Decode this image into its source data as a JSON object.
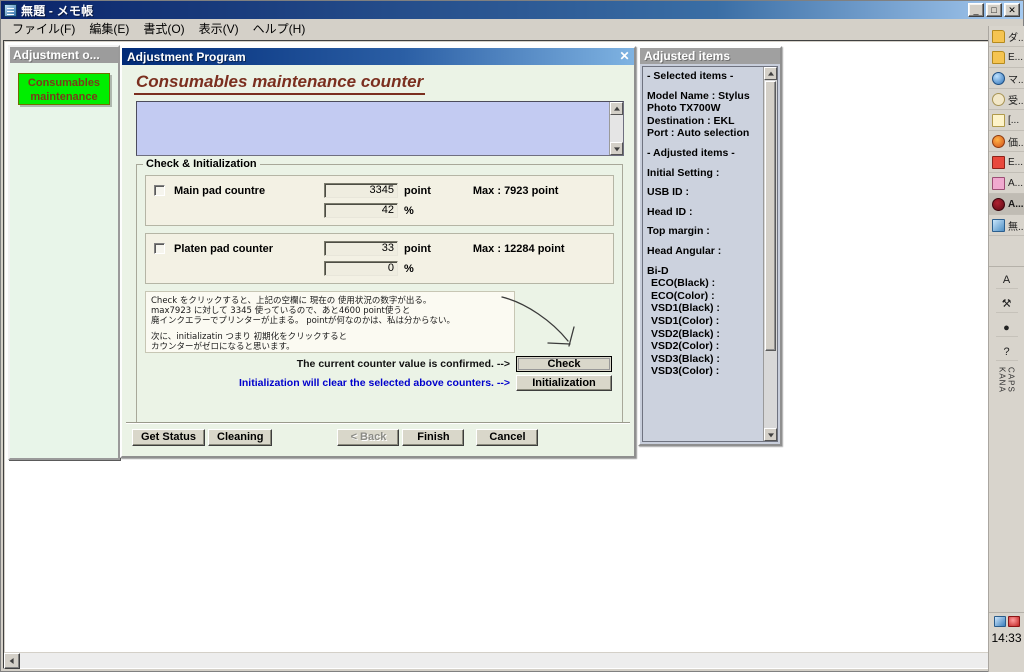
{
  "notepad": {
    "title": "無題 - メモ帳",
    "icon": "notepad-icon",
    "menu": [
      "ファイル(F)",
      "編集(E)",
      "書式(O)",
      "表示(V)",
      "ヘルプ(H)"
    ],
    "window_buttons": {
      "minimize": "_",
      "restore": "□",
      "close": "✕"
    }
  },
  "adjustment_owner": {
    "title": "Adjustment o...",
    "highlight_label": "Consumables maintenance counter"
  },
  "dialog": {
    "titlebar": "Adjustment Program",
    "close_label": "✕",
    "page_title": "Consumables maintenance counter",
    "log_text": "",
    "group_legend": "Check & Initialization",
    "counters": [
      {
        "name": "Main pad countre",
        "point_value": "3345",
        "point_unit": "point",
        "max_label": "Max : 7923 point",
        "percent_value": "42",
        "percent_unit": "%"
      },
      {
        "name": "Platen pad counter",
        "point_value": "33",
        "point_unit": "point",
        "max_label": "Max : 12284 point",
        "percent_value": "0",
        "percent_unit": "%"
      }
    ],
    "note_lines": [
      "Check をクリックすると、上記の空欄に 現在の 使用状況の数字が出る。",
      "max7923 に対して  3345  使っているので、あと4600 point使うと",
      "廃インクエラーでプリンターが止まる。 pointが何なのかは、私は分からない。",
      "",
      "次に、initializatin つまり 初期化をクリックすると",
      "カウンターがゼロになると思います。"
    ],
    "confirm_text": "The current counter value is confirmed. -->",
    "initialization_text": "Initialization will clear the selected above counters. -->",
    "check_button": "Check",
    "initialization_button": "Initialization",
    "footer_buttons": [
      {
        "label": "Get Status",
        "disabled": false
      },
      {
        "label": "Cleaning",
        "disabled": false
      },
      {
        "label": "< Back",
        "disabled": true
      },
      {
        "label": "Finish",
        "disabled": false
      },
      {
        "label": "Cancel",
        "disabled": false
      }
    ]
  },
  "adjusted_items": {
    "title": "Adjusted items",
    "lines": [
      {
        "text": "- Selected items -",
        "indent": false
      },
      {
        "text": "",
        "indent": false
      },
      {
        "text": "Model Name : Stylus",
        "indent": false
      },
      {
        "text": "Photo TX700W",
        "indent": false
      },
      {
        "text": "Destination : EKL",
        "indent": false
      },
      {
        "text": "Port : Auto selection",
        "indent": false
      },
      {
        "text": "",
        "indent": false
      },
      {
        "text": "- Adjusted items -",
        "indent": false
      },
      {
        "text": "",
        "indent": false
      },
      {
        "text": "Initial Setting :",
        "indent": false
      },
      {
        "text": "",
        "indent": false
      },
      {
        "text": "USB ID :",
        "indent": false
      },
      {
        "text": "",
        "indent": false
      },
      {
        "text": "Head ID :",
        "indent": false
      },
      {
        "text": "",
        "indent": false
      },
      {
        "text": "Top margin :",
        "indent": false
      },
      {
        "text": "",
        "indent": false
      },
      {
        "text": "Head Angular :",
        "indent": false
      },
      {
        "text": "",
        "indent": false
      },
      {
        "text": "Bi-D",
        "indent": false
      },
      {
        "text": "ECO(Black)  :",
        "indent": true
      },
      {
        "text": "ECO(Color)  :",
        "indent": true
      },
      {
        "text": "VSD1(Black) :",
        "indent": true
      },
      {
        "text": "VSD1(Color) :",
        "indent": true
      },
      {
        "text": "VSD2(Black) :",
        "indent": true
      },
      {
        "text": "VSD2(Color) :",
        "indent": true
      },
      {
        "text": "VSD3(Black) :",
        "indent": true
      },
      {
        "text": "VSD3(Color) :",
        "indent": true
      }
    ]
  },
  "right_toolbar": {
    "items": [
      {
        "icon": "folder-icon",
        "label": "ダ...",
        "active": false
      },
      {
        "icon": "folder-icon",
        "label": "E...",
        "active": false
      },
      {
        "icon": "globe-icon",
        "label": "マ...",
        "active": false
      },
      {
        "icon": "clock-icon",
        "label": "受...",
        "active": false
      },
      {
        "icon": "mail-icon",
        "label": "[...",
        "active": false
      },
      {
        "icon": "firefox-icon",
        "label": "価...",
        "active": false
      },
      {
        "icon": "pdf-icon",
        "label": "E...",
        "active": false
      },
      {
        "icon": "acrobat-icon",
        "label": "A...",
        "active": false
      },
      {
        "icon": "dark-circle-icon",
        "label": "A...",
        "active": true
      },
      {
        "icon": "window-icon",
        "label": "無...",
        "active": false
      }
    ],
    "ime": {
      "items": [
        "A",
        "wrench-icon",
        "pad-icon",
        "help-icon"
      ],
      "status": "CAPS KANA"
    },
    "clock": "14:33"
  },
  "colors": {
    "dialog_bg": "#ebf3e6",
    "title_blue": "#002a77",
    "heading_red": "#7b2f1f",
    "highlight_green": "#00ee00",
    "log_blue": "#c3cbf2",
    "link_blue": "#0000cc"
  }
}
